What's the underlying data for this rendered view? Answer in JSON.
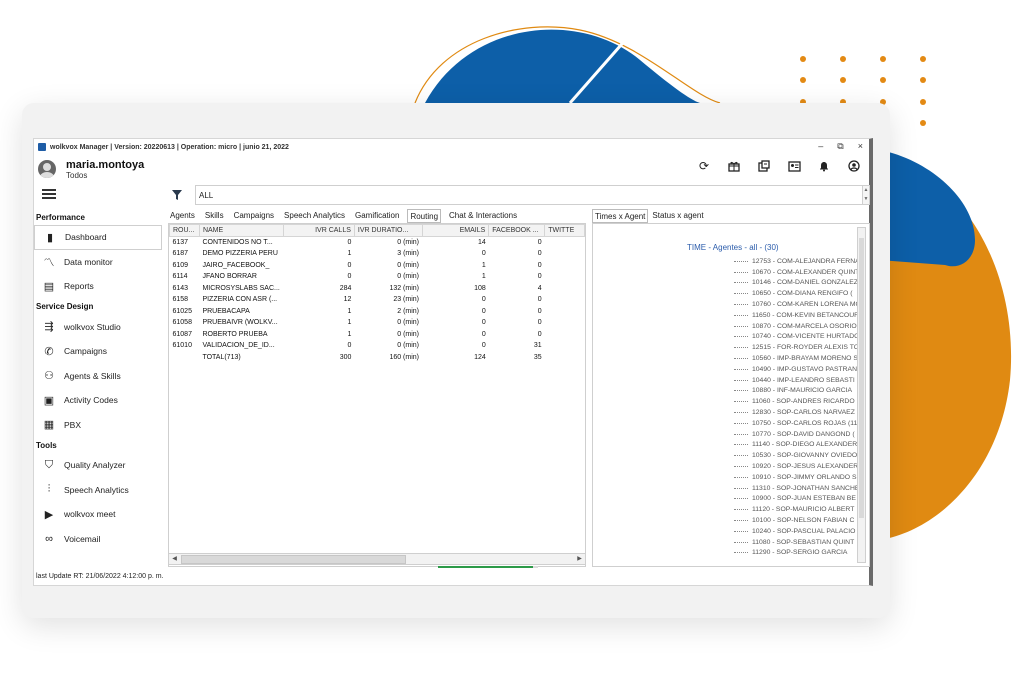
{
  "colors": {
    "blue_shape": "#0d5fa8",
    "orange_shape": "#e08a12",
    "dots": "#e38a14",
    "link_blue": "#2b5cab",
    "progress_green": "#2c9a48"
  },
  "window": {
    "title": "wolkvox Manager | Version: 20220613 | Operation: micro | junio 21, 2022",
    "controls": [
      "–",
      "⧉",
      "×"
    ]
  },
  "user": {
    "name": "maria.montoya",
    "subtitle": "Todos"
  },
  "top_icons": [
    "refresh-icon",
    "gift-icon",
    "export-icon",
    "contact-card-icon",
    "bell-icon",
    "user-circle-icon"
  ],
  "sidebar": {
    "sections": [
      {
        "title": "Performance",
        "items": [
          {
            "label": "Dashboard",
            "icon": "bar-chart-icon",
            "glyph": "▮",
            "active": true
          },
          {
            "label": "Data monitor",
            "icon": "line-chart-icon",
            "glyph": "〽"
          },
          {
            "label": "Reports",
            "icon": "report-icon",
            "glyph": "▤"
          }
        ]
      },
      {
        "title": "Service Design",
        "items": [
          {
            "label": "wolkvox Studio",
            "icon": "flow-icon",
            "glyph": "⇶"
          },
          {
            "label": "Campaigns",
            "icon": "megaphone-icon",
            "glyph": "✆"
          },
          {
            "label": "Agents & Skills",
            "icon": "agents-icon",
            "glyph": "⚇"
          },
          {
            "label": "Activity Codes",
            "icon": "code-icon",
            "glyph": "▣"
          },
          {
            "label": "PBX",
            "icon": "pbx-icon",
            "glyph": "▦"
          }
        ]
      },
      {
        "title": "Tools",
        "items": [
          {
            "label": "Quality Analyzer",
            "icon": "shield-icon",
            "glyph": "⛉"
          },
          {
            "label": "Speech Analytics",
            "icon": "waveform-icon",
            "glyph": "⫶"
          },
          {
            "label": "wolkvox meet",
            "icon": "video-icon",
            "glyph": "▶"
          },
          {
            "label": "Voicemail",
            "icon": "voicemail-icon",
            "glyph": "∞"
          }
        ]
      }
    ]
  },
  "filter": {
    "value": "ALL"
  },
  "tabs_left": [
    {
      "label": "Agents"
    },
    {
      "label": "Skills"
    },
    {
      "label": "Campaigns"
    },
    {
      "label": "Speech Analytics"
    },
    {
      "label": "Gamification"
    },
    {
      "label": "Routing",
      "active": true
    },
    {
      "label": "Chat & Interactions"
    }
  ],
  "routing_table": {
    "columns": [
      "ROU...",
      "NAME",
      "IVR CALLS",
      "IVR DURATIO...",
      "EMAILS",
      "FACEBOOK ...",
      "TWITTE"
    ],
    "rows": [
      [
        "6137",
        "CONTENIDOS NO T...",
        "0",
        "0 (min)",
        "14",
        "0",
        ""
      ],
      [
        "6187",
        "DEMO PIZZERIA PERU",
        "1",
        "3 (min)",
        "0",
        "0",
        ""
      ],
      [
        "6109",
        "JAIRO_FACEBOOK_",
        "0",
        "0 (min)",
        "1",
        "0",
        ""
      ],
      [
        "6114",
        "JFANO BORRAR",
        "0",
        "0 (min)",
        "1",
        "0",
        ""
      ],
      [
        "6143",
        "MICROSYSLABS SAC...",
        "284",
        "132 (min)",
        "108",
        "4",
        ""
      ],
      [
        "6158",
        "PIZZERIA CON ASR (...",
        "12",
        "23 (min)",
        "0",
        "0",
        ""
      ],
      [
        "61025",
        "PRUEBACAPA",
        "1",
        "2 (min)",
        "0",
        "0",
        ""
      ],
      [
        "61058",
        "PRUEBAIVR (WOLKV...",
        "1",
        "0 (min)",
        "0",
        "0",
        ""
      ],
      [
        "61087",
        "ROBERTO PRUEBA",
        "1",
        "0 (min)",
        "0",
        "0",
        ""
      ],
      [
        "61010",
        "VALIDACION_DE_ID...",
        "0",
        "0 (min)",
        "0",
        "31",
        ""
      ],
      [
        "",
        "TOTAL(713)",
        "300",
        "160 (min)",
        "124",
        "35",
        ""
      ]
    ]
  },
  "tabs_right": [
    {
      "label": "Times x Agent",
      "active": true
    },
    {
      "label": "Status x agent"
    }
  ],
  "agent_tree": {
    "root": "TIME - Agentes - all - (30)",
    "items": [
      "12753 - COM-ALEJANDRA FERNA",
      "10670 - COM-ALEXANDER QUINT",
      "10146 - COM-DANIEL GONZALEZ",
      "10650 - COM-DIANA RENGIFO (",
      "10760 - COM-KAREN LORENA MO",
      "11650 - COM-KEVIN BETANCOUR",
      "10870 - COM-MARCELA OSORIO",
      "10740 - COM-VICENTE HURTADO",
      "12515 - FOR-ROYDER ALEXIS TO",
      "10560 - IMP-BRAYAM MORENO S",
      "10490 - IMP-GUSTAVO PASTRAN",
      "10440 - IMP-LEANDRO SEBASTI",
      "10880 - INF-MAURICIO GARCIA",
      "11060 - SOP-ANDRES RICARDO",
      "12830 - SOP-CARLOS NARVAEZ (",
      "10750 - SOP-CARLOS ROJAS (11",
      "10770 - SOP-DAVID DANGOND (",
      "11140 - SOP-DIEGO ALEXANDER",
      "10530 - SOP-GIOVANNY OVIEDO",
      "10920 - SOP-JESUS ALEXANDER",
      "10910 - SOP-JIMMY ORLANDO S",
      "11310 - SOP-JONATHAN SANCHE",
      "10900 - SOP-JUAN ESTEBAN BE",
      "11120 - SOP-MAURICIO ALBERT",
      "10100 - SOP-NELSON FABIAN C",
      "10240 - SOP-PASCUAL PALACIO",
      "11080 - SOP-SEBASTIAN QUINT",
      "11290 - SOP-SERGIO GARCIA"
    ]
  },
  "status_bar": {
    "text": "last Update RT: 21/06/2022 4:12:00 p. m."
  },
  "loading_progress": 0.95
}
